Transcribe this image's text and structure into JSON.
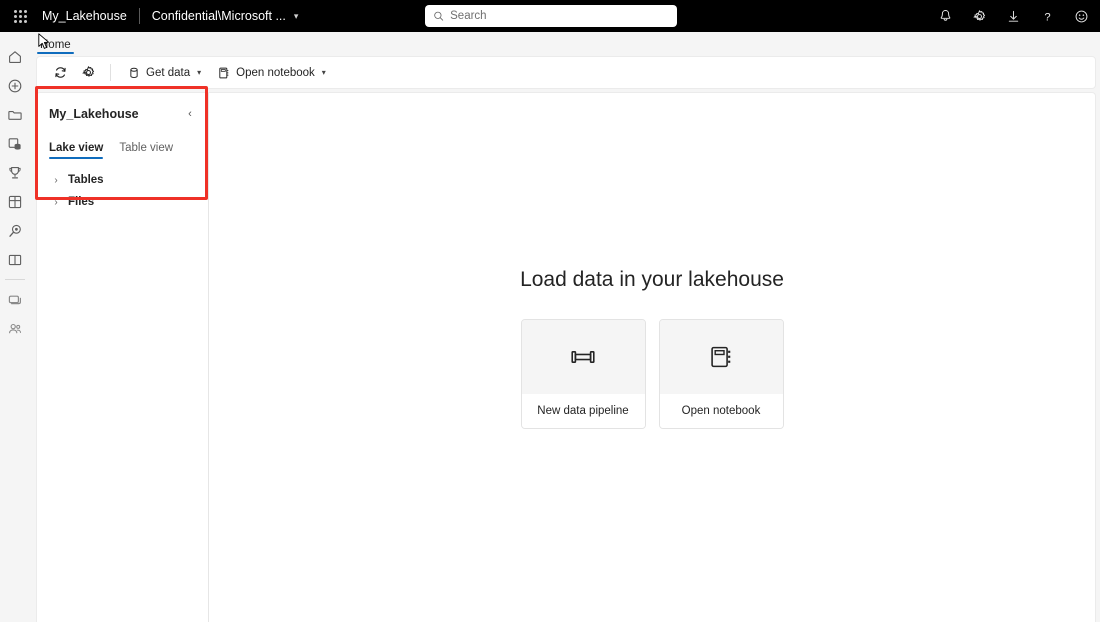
{
  "topbar": {
    "waffle_label": "app-launcher",
    "app_title": "My_Lakehouse",
    "tenant_label": "Confidential\\Microsoft ...",
    "tenant_chevron": "⌄",
    "search_placeholder": "Search",
    "search_value": "",
    "actions": [
      {
        "name": "notifications-icon",
        "label": "Notifications"
      },
      {
        "name": "settings-icon",
        "label": "Settings"
      },
      {
        "name": "download-icon",
        "label": "Downloads"
      },
      {
        "name": "help-icon",
        "label": "Help"
      },
      {
        "name": "feedback-icon",
        "label": "Feedback"
      }
    ]
  },
  "rail": {
    "items": [
      {
        "name": "home",
        "label": "Home"
      },
      {
        "name": "create",
        "label": "Create"
      },
      {
        "name": "browse",
        "label": "Browse"
      },
      {
        "name": "onelake",
        "label": "OneLake data hub"
      },
      {
        "name": "goals",
        "label": "Metrics"
      },
      {
        "name": "workspaces",
        "label": "Workspaces"
      },
      {
        "name": "deploy",
        "label": "Deployment pipelines"
      },
      {
        "name": "learn",
        "label": "Learn"
      },
      {
        "name": "monitor",
        "label": "Monitoring hub"
      },
      {
        "name": "contacts",
        "label": "Contacts"
      }
    ]
  },
  "tabs": [
    {
      "label": "Home",
      "active": true
    }
  ],
  "toolbar": {
    "refresh_label": "Refresh",
    "settings_label": "Settings",
    "get_data_label": "Get data",
    "open_notebook_label": "Open notebook",
    "chevron": "⌄"
  },
  "explorer": {
    "title": "My_Lakehouse",
    "collapse_glyph": "‹",
    "view_tabs": [
      {
        "label": "Lake view",
        "active": true
      },
      {
        "label": "Table view",
        "active": false
      }
    ],
    "tree": [
      {
        "label": "Tables",
        "chevron": "›",
        "expanded": false
      },
      {
        "label": "Files",
        "chevron": "›",
        "expanded": false
      }
    ]
  },
  "main": {
    "title": "Load data in your lakehouse",
    "cards": [
      {
        "label": "New data pipeline",
        "icon": "pipeline-icon"
      },
      {
        "label": "Open notebook",
        "icon": "notebook-icon"
      }
    ]
  },
  "annotation": {
    "highlight_color": "#ef3127",
    "target": "explorer-panel"
  },
  "theme": {
    "accent": "#0f6cbd",
    "topbar_bg": "#000000",
    "canvas_bg": "#f5f5f5",
    "panel_bg": "#ffffff",
    "text": "#242424"
  }
}
